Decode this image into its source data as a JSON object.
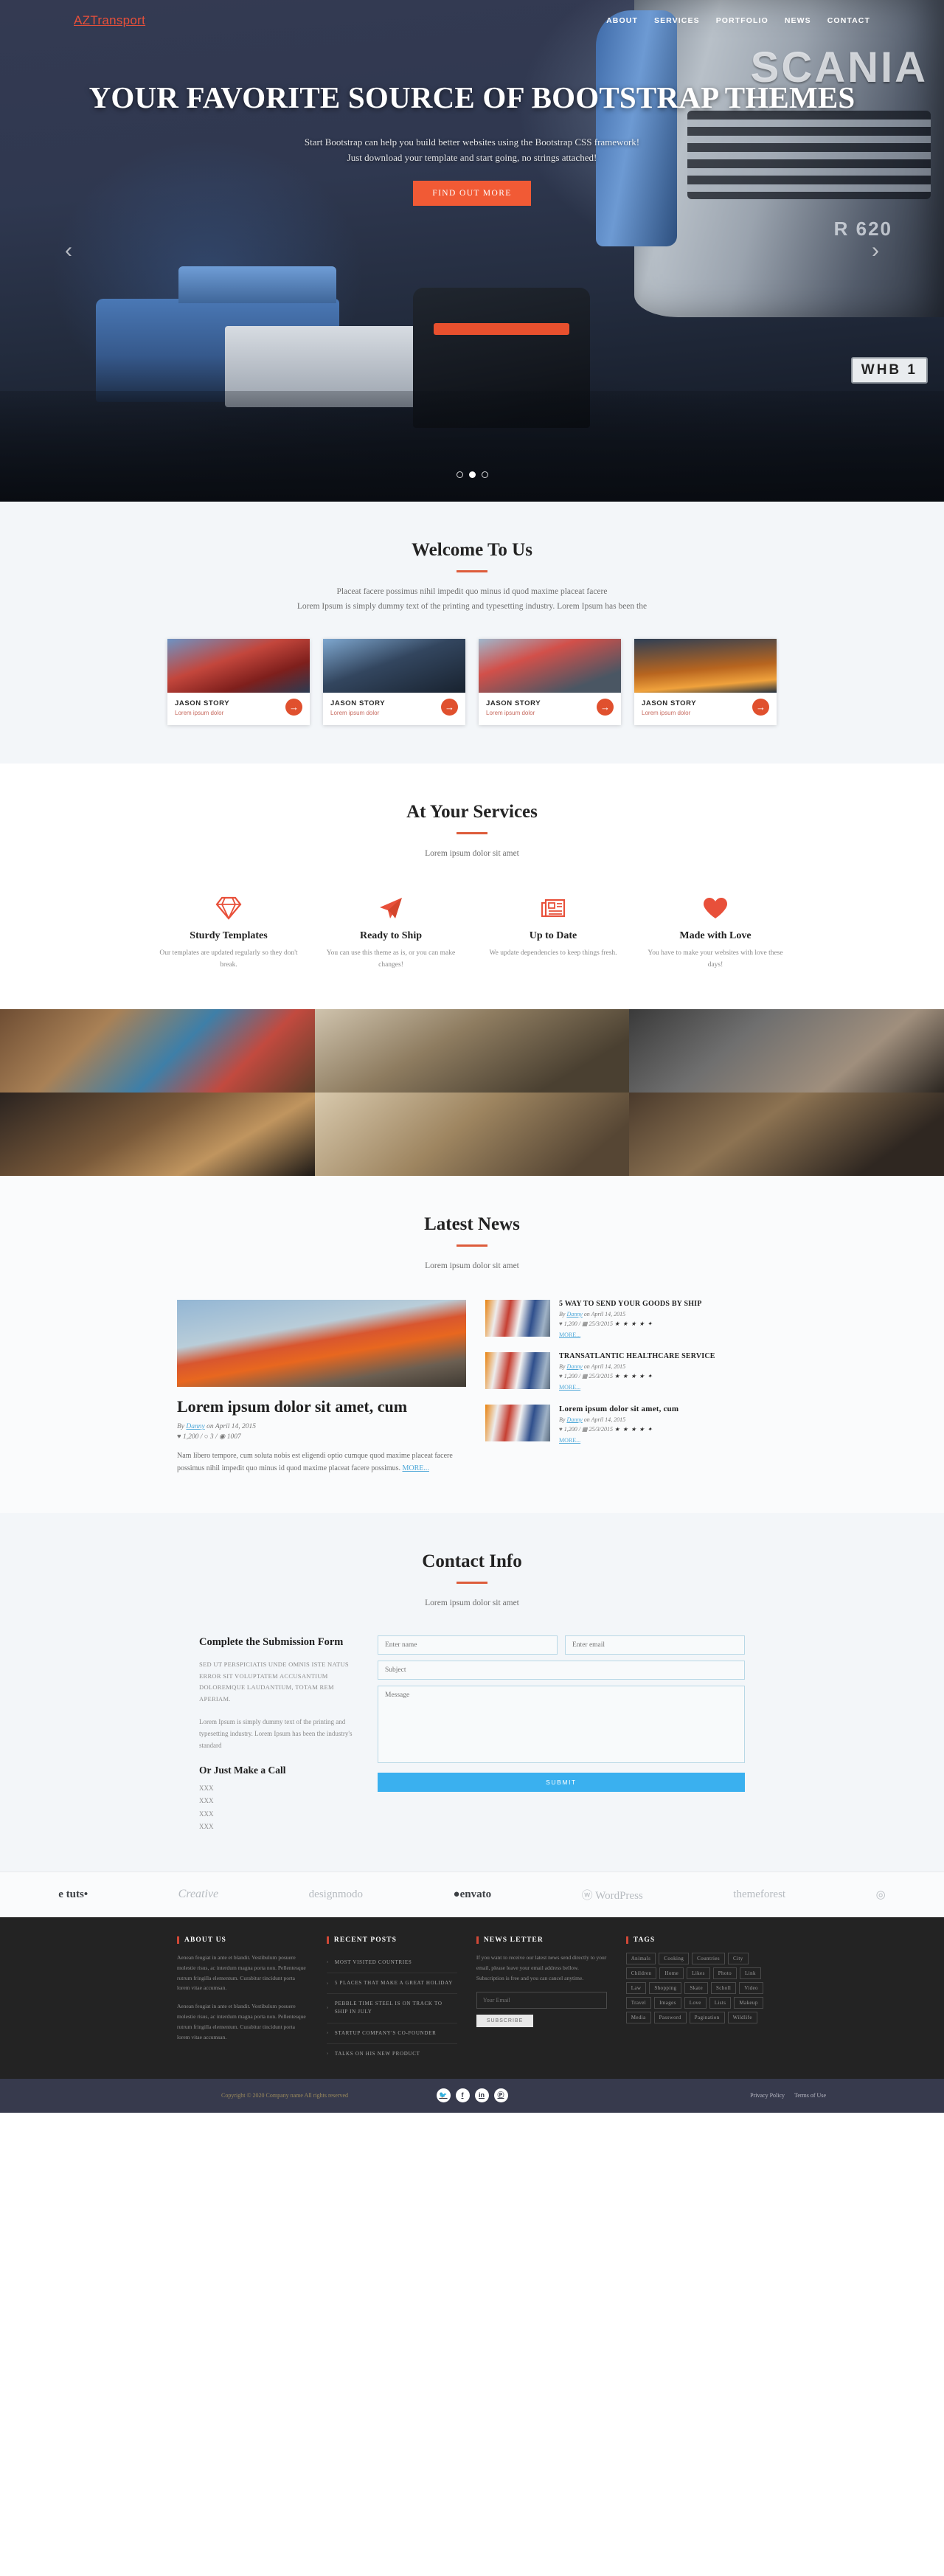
{
  "header": {
    "brand": "AZTransport",
    "nav": [
      "ABOUT",
      "SERVICES",
      "PORTFOLIO",
      "NEWS",
      "CONTACT"
    ]
  },
  "hero": {
    "title": "YOUR FAVORITE SOURCE OF BOOTSTRAP THEMES",
    "sub_line1": "Start Bootstrap can help you build better websites using the Bootstrap CSS framework!",
    "sub_line2": "Just download your template and start going, no strings attached!",
    "cta": "FIND OUT MORE",
    "arrow_left": "‹",
    "arrow_right": "›",
    "badge_scania": "SCANIA",
    "badge_model": "R 620",
    "plate": "WHB  1"
  },
  "welcome": {
    "title": "Welcome To Us",
    "lead_line1": "Placeat facere possimus nihil impedit quo minus id quod maxime placeat facere",
    "lead_line2": "Lorem Ipsum is simply dummy text of the printing and typesetting industry. Lorem Ipsum has been the",
    "cards": [
      {
        "title": "JASON STORY",
        "subtitle": "Lorem ipsum dolor",
        "arrow": "→"
      },
      {
        "title": "JASON STORY",
        "subtitle": "Lorem ipsum dolor",
        "arrow": "→"
      },
      {
        "title": "JASON STORY",
        "subtitle": "Lorem ipsum dolor",
        "arrow": "→"
      },
      {
        "title": "JASON STORY",
        "subtitle": "Lorem ipsum dolor",
        "arrow": "→"
      }
    ]
  },
  "services": {
    "title": "At Your Services",
    "lead": "Lorem ipsum dolor sit amet",
    "items": [
      {
        "icon": "diamond-icon",
        "title": "Sturdy Templates",
        "text": "Our templates are updated regularly so they don't break."
      },
      {
        "icon": "paper-plane-icon",
        "title": "Ready to Ship",
        "text": "You can use this theme as is, or you can make changes!"
      },
      {
        "icon": "newspaper-icon",
        "title": "Up to Date",
        "text": "We update dependencies to keep things fresh."
      },
      {
        "icon": "heart-icon",
        "title": "Made with Love",
        "text": "You have to make your websites with love these days!"
      }
    ]
  },
  "news": {
    "title": "Latest News",
    "lead": "Lorem ipsum dolor sit amet",
    "main": {
      "headline": "Lorem ipsum dolor sit amet, cum",
      "by_prefix": "By ",
      "author": "Danny",
      "by_suffix": " on April 14, 2015",
      "stats": "♥ 1,200 / ○ 3 / ◉ 1007",
      "body": "Nam libero tempore, cum soluta nobis est eligendi optio cumque quod maxime placeat facere possimus nihil impedit quo minus id quod maxime placeat facere possimus. ",
      "more": "MORE..."
    },
    "side": [
      {
        "title": "5 WAY TO SEND YOUR GOODS BY SHIP",
        "by_prefix": "By ",
        "author": "Danny",
        "by_suffix": " on April 14, 2015",
        "stats": "♥ 1,200 / ▦ 25/3/2015",
        "stars": "★ ★ ★ ★ ✦",
        "more": "MORE..."
      },
      {
        "title": "TRANSATLANTIC HEALTHCARE SERVICE",
        "by_prefix": "By ",
        "author": "Danny",
        "by_suffix": " on April 14, 2015",
        "stats": "♥ 1,200 / ▦ 25/3/2015",
        "stars": "★ ★ ★ ★ ✦",
        "more": "MORE..."
      },
      {
        "title": "Lorem ipsum dolor sit amet, cum",
        "by_prefix": "By ",
        "author": "Danny",
        "by_suffix": " on April 14, 2015",
        "stats": "♥ 1,200 / ▦ 25/3/2015",
        "stars": "★ ★ ★ ★ ✦",
        "more": "MORE..."
      }
    ]
  },
  "contact": {
    "title": "Contact Info",
    "lead": "Lorem ipsum dolor sit amet",
    "left_heading": "Complete the Submission Form",
    "caps_text": "SED UT PERSPICIATIS UNDE OMNIS ISTE NATUS ERROR SIT VOLUPTATEM ACCUSANTIUM DOLOREMQUE LAUDANTIUM, TOTAM REM APERIAM.",
    "paragraph": "Lorem Ipsum is simply dummy text of the printing and typesetting industry. Lorem Ipsum has been the industry's standard",
    "call_heading": "Or Just Make a Call",
    "phones": [
      "XXX",
      "XXX",
      "XXX",
      "XXX"
    ],
    "form": {
      "name_placeholder": "Enter name",
      "email_placeholder": "Enter email",
      "subject_placeholder": "Subject",
      "message_placeholder": "Message",
      "submit_label": "SUBMIT"
    }
  },
  "brands": [
    "e tuts•",
    "Creative",
    "designmodo",
    "●envato",
    "ⓦ WordPress",
    "themeforest",
    "◎"
  ],
  "footer": {
    "about": {
      "heading": "ABOUT US",
      "p1": "Aenean feugiat in ante et blandit. Vestibulum posuere molestie risus, ac interdum magna porta non. Pellentesque rutrum fringilla elementum. Curabitur tincidunt porta lorem vitae accumsan.",
      "p2": "Aenean feugiat in ante et blandit. Vestibulum posuere molestie risus, ac interdum magna porta non. Pellentesque rutrum fringilla elementum. Curabitur tincidunt porta lorem vitae accumsan."
    },
    "recent": {
      "heading": "RECENT POSTS",
      "items": [
        "MOST VISITED COUNTRIES",
        "5 PLACES THAT MAKE A GREAT HOLIDAY",
        "PEBBLE TIME STEEL IS ON TRACK TO SHIP IN JULY",
        "STARTUP COMPANY'S CO-FOUNDER",
        "TALKS ON HIS NEW PRODUCT"
      ]
    },
    "newsletter": {
      "heading": "NEWS LETTER",
      "text": "If you want to receive our latest news send directly to your email, please leave your email address bellow. Subscription is free and you can cancel anytime.",
      "placeholder": "Your Email",
      "button": "SUBSCRIBE"
    },
    "tags": {
      "heading": "TAGS",
      "items": [
        "Animals",
        "Cooking",
        "Countries",
        "City",
        "Children",
        "Home",
        "Likes",
        "Photo",
        "Link",
        "Law",
        "Shopping",
        "Skate",
        "Scholl",
        "Video",
        "Travel",
        "Images",
        "Love",
        "Lists",
        "Makeup",
        "Media",
        "Password",
        "Pagination",
        "Wildlife"
      ]
    }
  },
  "bottom": {
    "copyright": "Copyright © 2020 Company name All rights reserved",
    "socials": [
      "twitter-icon",
      "facebook-icon",
      "linkedin-icon",
      "pinterest-icon"
    ],
    "social_glyphs": [
      "🐦",
      "f",
      "in",
      "Ⓟ"
    ],
    "legal": [
      "Privacy Policy",
      "Terms of Use"
    ]
  },
  "colors": {
    "accent": "#e8503a",
    "rule": "#dd5c3b",
    "link": "#4fa8d8",
    "submit": "#3ab0ef",
    "footer_bg": "#232323",
    "bottom_bg": "#373a4d"
  }
}
